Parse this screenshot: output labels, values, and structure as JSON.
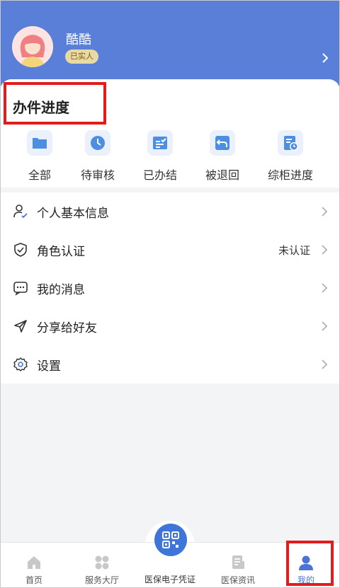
{
  "user": {
    "name": "酷酷",
    "badge": "已实人"
  },
  "progress": {
    "title": "办件进度",
    "items": [
      {
        "label": "全部",
        "icon": "folder-icon"
      },
      {
        "label": "待审核",
        "icon": "clock-icon"
      },
      {
        "label": "已办结",
        "icon": "completed-document-icon"
      },
      {
        "label": "被退回",
        "icon": "return-arrow-icon"
      },
      {
        "label": "综柜进度",
        "icon": "document-clock-icon"
      }
    ]
  },
  "menu": {
    "items": [
      {
        "label": "个人基本信息",
        "value": "",
        "icon": "user-check-icon"
      },
      {
        "label": "角色认证",
        "value": "未认证",
        "icon": "shield-check-icon"
      },
      {
        "label": "我的消息",
        "value": "",
        "icon": "message-icon"
      },
      {
        "label": "分享给好友",
        "value": "",
        "icon": "send-icon"
      },
      {
        "label": "设置",
        "value": "",
        "icon": "gear-icon"
      }
    ]
  },
  "tabbar": {
    "items": [
      {
        "label": "首页",
        "icon": "home-icon"
      },
      {
        "label": "服务大厅",
        "icon": "grid-icon"
      },
      {
        "label": "医保电子凭证",
        "icon": "qr-code-icon"
      },
      {
        "label": "医保资讯",
        "icon": "news-icon"
      },
      {
        "label": "我的",
        "icon": "person-icon"
      }
    ],
    "active_index": 4
  },
  "colors": {
    "header": "#5a7fd8",
    "accent": "#4c74d4",
    "highlight": "#e31b1b",
    "badge": "#e9d9a2"
  }
}
